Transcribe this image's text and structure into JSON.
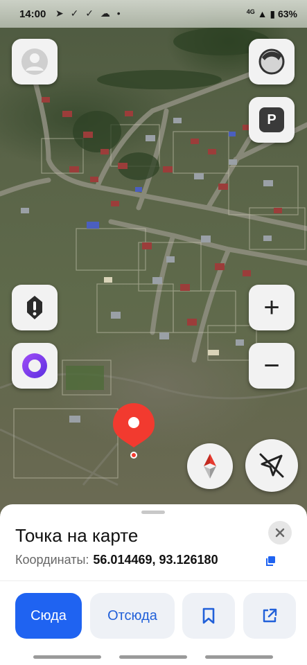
{
  "status_bar": {
    "time": "14:00",
    "icons": "➤ ✓ ✓ ☁ •",
    "network_label": "4G",
    "battery": "63%"
  },
  "map_controls": {
    "profile": "profile-avatar-icon",
    "layers": "layers-icon",
    "parking_label": "P",
    "alert": "alert-icon",
    "alice": "alice-assistant-icon",
    "zoom_in": "+",
    "zoom_out": "−",
    "compass": "compass-icon",
    "location": "location-arrow-icon"
  },
  "place_card": {
    "title": "Точка на карте",
    "coords_label": "Координаты:",
    "coords_value": "56.014469, 93.126180"
  },
  "actions": {
    "route_to": "Сюда",
    "route_from": "Отсюда"
  },
  "colors": {
    "accent": "#1f63f1",
    "marker": "#f23a2f"
  }
}
